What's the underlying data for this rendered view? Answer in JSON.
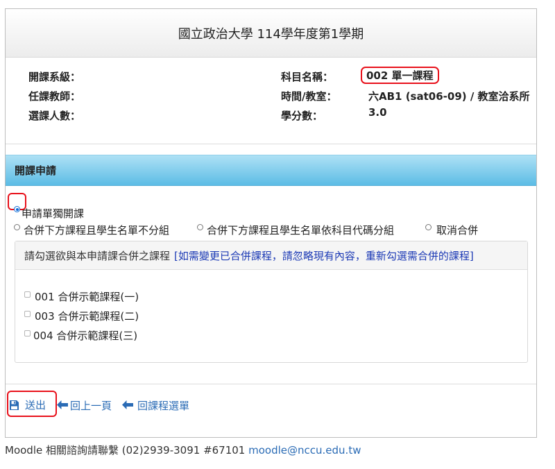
{
  "header": {
    "title": "國立政治大學 114學年度第1學期"
  },
  "info": {
    "dept_label": "開課系級：",
    "teacher_label": "任課教師：",
    "enroll_label": "選課人數：",
    "course_name_label": "科目名稱：",
    "course_name_value": "002 單一課程",
    "time_room_label": "時間/教室：",
    "time_room_value": "六AB1 (sat06-09) / 教室洽系所",
    "credits_label": "學分數：",
    "credits_value": "3.0"
  },
  "section": {
    "title": "開課申請"
  },
  "options": {
    "single": "申請單獨開課",
    "merge_no_split": "合併下方課程且學生名單不分組",
    "merge_split": "合併下方課程且學生名單依科目代碼分組",
    "cancel": "取消合併",
    "selected": "single"
  },
  "merge": {
    "instruction": "請勾選欲與本申請課合併之課程",
    "note": "[如需變更已合併課程，請忽略現有內容，重新勾選需合併的課程]",
    "courses": [
      {
        "label": "001 合併示範課程(一)",
        "checked": false
      },
      {
        "label": "003 合併示範課程(二)",
        "checked": false
      },
      {
        "label": "004 合併示範課程(三)",
        "checked": false
      }
    ]
  },
  "actions": {
    "submit": "送出",
    "back": "回上一頁",
    "back_course": "回課程選單"
  },
  "footer": {
    "text": "Moodle 相關諮詢請聯繫 (02)2939-3091 #67101",
    "email": "moodle@nccu.edu.tw"
  },
  "colors": {
    "accent_red": "#e8101a",
    "link_blue": "#2a6bb5",
    "header_blue": "#5cbce5"
  }
}
